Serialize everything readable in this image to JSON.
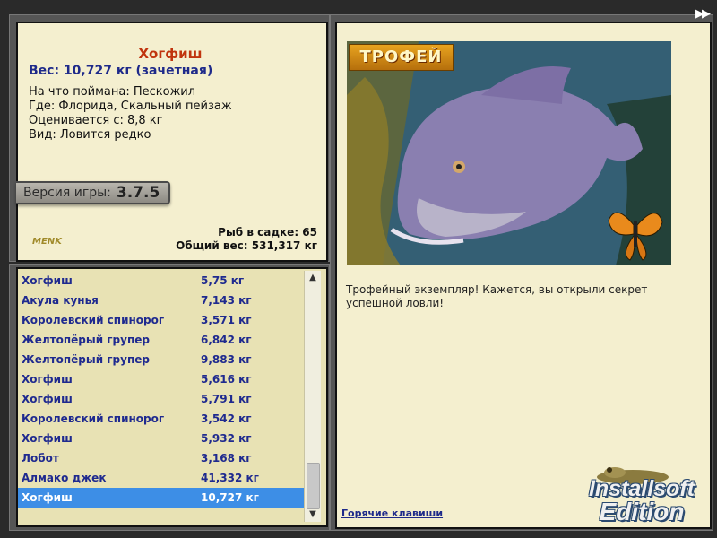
{
  "fish": {
    "name": "Хогфиш",
    "weight_line": "Вес: 10,727 кг (зачетная)",
    "details": [
      "На что поймана: Пескожил",
      "Где: Флорида, Скальный пейзаж",
      "Оценивается с: 8,8 кг",
      "Вид: Ловится редко"
    ]
  },
  "version": {
    "label": "Версия игры:",
    "number": "3.7.5"
  },
  "logo": "MENK",
  "counts": {
    "in_cage": "Рыб в садке: 65",
    "total_weight": "Общий вес: 531,317 кг"
  },
  "catch_list": [
    {
      "name": "Хогфиш",
      "weight": "5,75 кг"
    },
    {
      "name": "Акула кунья",
      "weight": "7,143 кг"
    },
    {
      "name": "Королевский спинорог",
      "weight": "3,571 кг"
    },
    {
      "name": "Желтопёрый групер",
      "weight": "6,842 кг"
    },
    {
      "name": "Желтопёрый групер",
      "weight": "9,883 кг"
    },
    {
      "name": "Хогфиш",
      "weight": "5,616 кг"
    },
    {
      "name": "Хогфиш",
      "weight": "5,791 кг"
    },
    {
      "name": "Королевский спинорог",
      "weight": "3,542 кг"
    },
    {
      "name": "Хогфиш",
      "weight": "5,932 кг"
    },
    {
      "name": "Лобот",
      "weight": "3,168 кг"
    },
    {
      "name": "Алмако джек",
      "weight": "41,332 кг"
    },
    {
      "name": "Хогфиш",
      "weight": "10,727 кг",
      "selected": true
    }
  ],
  "trophy_badge": "ТРОФЕЙ",
  "description": "Трофейный экземпляр! Кажется, вы открыли секрет успешной ловли!",
  "hotkeys_link": "Горячие клавиши",
  "brand": {
    "line1": "Installsoft",
    "line2": "Edition"
  },
  "icons": {
    "fast_forward": "fast-forward-icon",
    "scroll_up": "chevron-up-icon",
    "scroll_down": "chevron-down-icon",
    "fish_picture": "fish-photo",
    "butterfly": "butterfly-icon"
  },
  "colors": {
    "panel_bg": "#f4efcf",
    "title_red": "#c0340e",
    "text_blue": "#1e2a8a",
    "selection": "#3d8ee6",
    "trophy_orange": "#e8a31f"
  }
}
